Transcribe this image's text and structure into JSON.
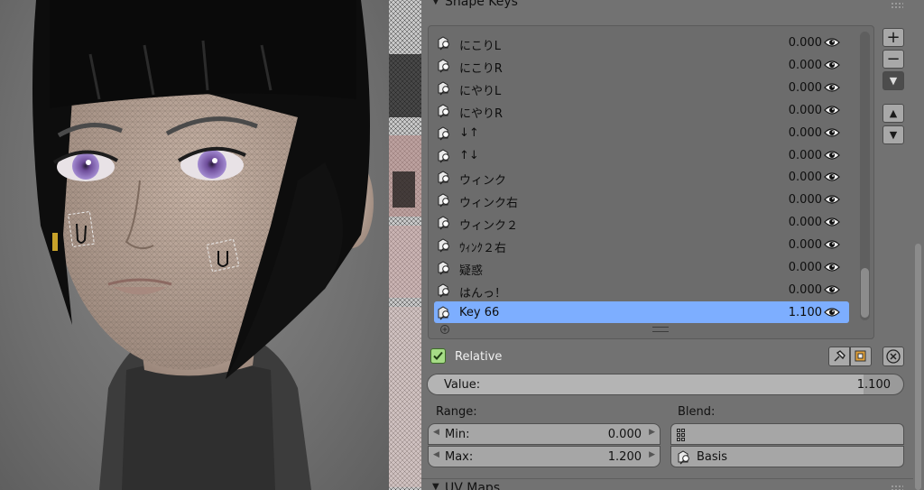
{
  "panel_title": "Shape Keys",
  "shape_keys": [
    {
      "name": "にこりL",
      "value": "0.000"
    },
    {
      "name": "にこりR",
      "value": "0.000"
    },
    {
      "name": "にやりL",
      "value": "0.000"
    },
    {
      "name": "にやりR",
      "value": "0.000"
    },
    {
      "name": "↓↑",
      "value": "0.000"
    },
    {
      "name": "↑↓",
      "value": "0.000"
    },
    {
      "name": "ウィンク",
      "value": "0.000"
    },
    {
      "name": "ウィンク右",
      "value": "0.000"
    },
    {
      "name": "ウィンク２",
      "value": "0.000"
    },
    {
      "name": "ｳｨﾝｸ２右",
      "value": "0.000"
    },
    {
      "name": "疑惑",
      "value": "0.000"
    },
    {
      "name": "はんっ！",
      "value": "0.000"
    },
    {
      "name": "Key 66",
      "value": "1.100",
      "active": true
    }
  ],
  "relative": {
    "label": "Relative",
    "checked": true
  },
  "value_slider": {
    "label": "Value:",
    "value": "1.100",
    "fraction": 0.917
  },
  "range": {
    "label": "Range:",
    "min_label": "Min:",
    "min_value": "0.000",
    "max_label": "Max:",
    "max_value": "1.200"
  },
  "blend": {
    "label": "Blend:",
    "vertex_group": "",
    "key": "Basis"
  },
  "next_panel_title": "UV Maps",
  "icons": {
    "key": "shape-key-icon",
    "eye": "eye-icon",
    "add": "plus-icon",
    "remove": "minus-icon",
    "menu": "dropdown-arrow-icon",
    "up": "move-up-icon",
    "down": "move-down-icon",
    "pin": "pin-icon",
    "edit": "edit-mode-icon",
    "clear": "clear-icon"
  },
  "colors": {
    "active_row": "#7daeff",
    "checkbox": "#a6dc86",
    "panel_bg": "#727272"
  }
}
